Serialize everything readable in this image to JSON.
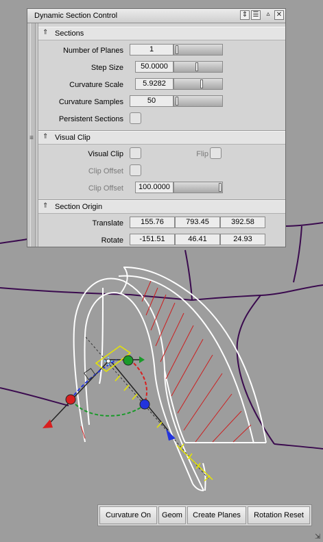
{
  "window": {
    "title": "Dynamic Section Control",
    "title_buttons": [
      "collapse-icon",
      "list-icon",
      "caret-up-icon",
      "close-icon"
    ]
  },
  "sections": {
    "header": "Sections",
    "rows": {
      "number_of_planes": {
        "label": "Number of Planes",
        "value": "1",
        "slider_level": 0.0
      },
      "step_size": {
        "label": "Step Size",
        "value": "50.0000",
        "slider_level": 0.45
      },
      "curvature_scale": {
        "label": "Curvature Scale",
        "value": "5.9282",
        "slider_level": 0.55
      },
      "curvature_samples": {
        "label": "Curvature Samples",
        "value": "50",
        "slider_level": 0.05
      },
      "persistent_sections": {
        "label": "Persistent Sections",
        "checked": false
      }
    }
  },
  "visual_clip": {
    "header": "Visual Clip",
    "visual_clip_label": "Visual Clip",
    "flip_label": "Flip",
    "clip_offset_check_label": "Clip Offset",
    "clip_offset_label": "Clip Offset",
    "clip_offset_value": "100.0000",
    "clip_offset_slider_level": 1.0
  },
  "section_origin": {
    "header": "Section Origin",
    "translate": {
      "label": "Translate",
      "values": [
        "155.76",
        "793.45",
        "392.58"
      ]
    },
    "rotate": {
      "label": "Rotate",
      "values": [
        "-151.51",
        "46.41",
        "24.93"
      ]
    }
  },
  "toolbar": {
    "curvature_on": "Curvature On",
    "geom": "Geom",
    "create_planes": "Create Planes",
    "rotation_reset": "Rotation Reset"
  },
  "colors": {
    "viewport_bg": "#9d9d9d",
    "surface_edges": "#3a0a4e",
    "model_outline": "#ffffff",
    "curvature_hatch": "#cc1f1f",
    "gizmo_x": "#d81f1f",
    "gizmo_y": "#1a9a2a",
    "gizmo_z": "#2233dd",
    "gizmo_plane": "#e6e600"
  }
}
